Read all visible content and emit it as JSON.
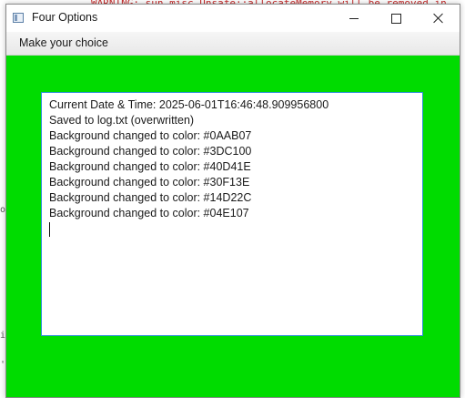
{
  "background": {
    "warning_text": "WARNING: sun.misc.Unsafe::allocateMemory will be removed in"
  },
  "window": {
    "title": "Four Options",
    "background_color": "#00DC00",
    "controls": {
      "minimize_icon": "minimize-icon",
      "maximize_icon": "maximize-icon",
      "close_icon": "close-icon"
    }
  },
  "menu": {
    "items": [
      {
        "label": "Make your choice"
      }
    ]
  },
  "log": {
    "lines": [
      "Current Date & Time: 2025-06-01T16:46:48.909956800",
      "Saved to log.txt (overwritten)",
      "Background changed to color: #0AAB07",
      "Background changed to color: #3DC100",
      "Background changed to color: #40D41E",
      "Background changed to color: #30F13E",
      "Background changed to color: #14D22C",
      "Background changed to color: #04E107"
    ]
  },
  "colors": {
    "accent_border": "#2D8FD6",
    "titlebar": "#FFFFFF"
  }
}
